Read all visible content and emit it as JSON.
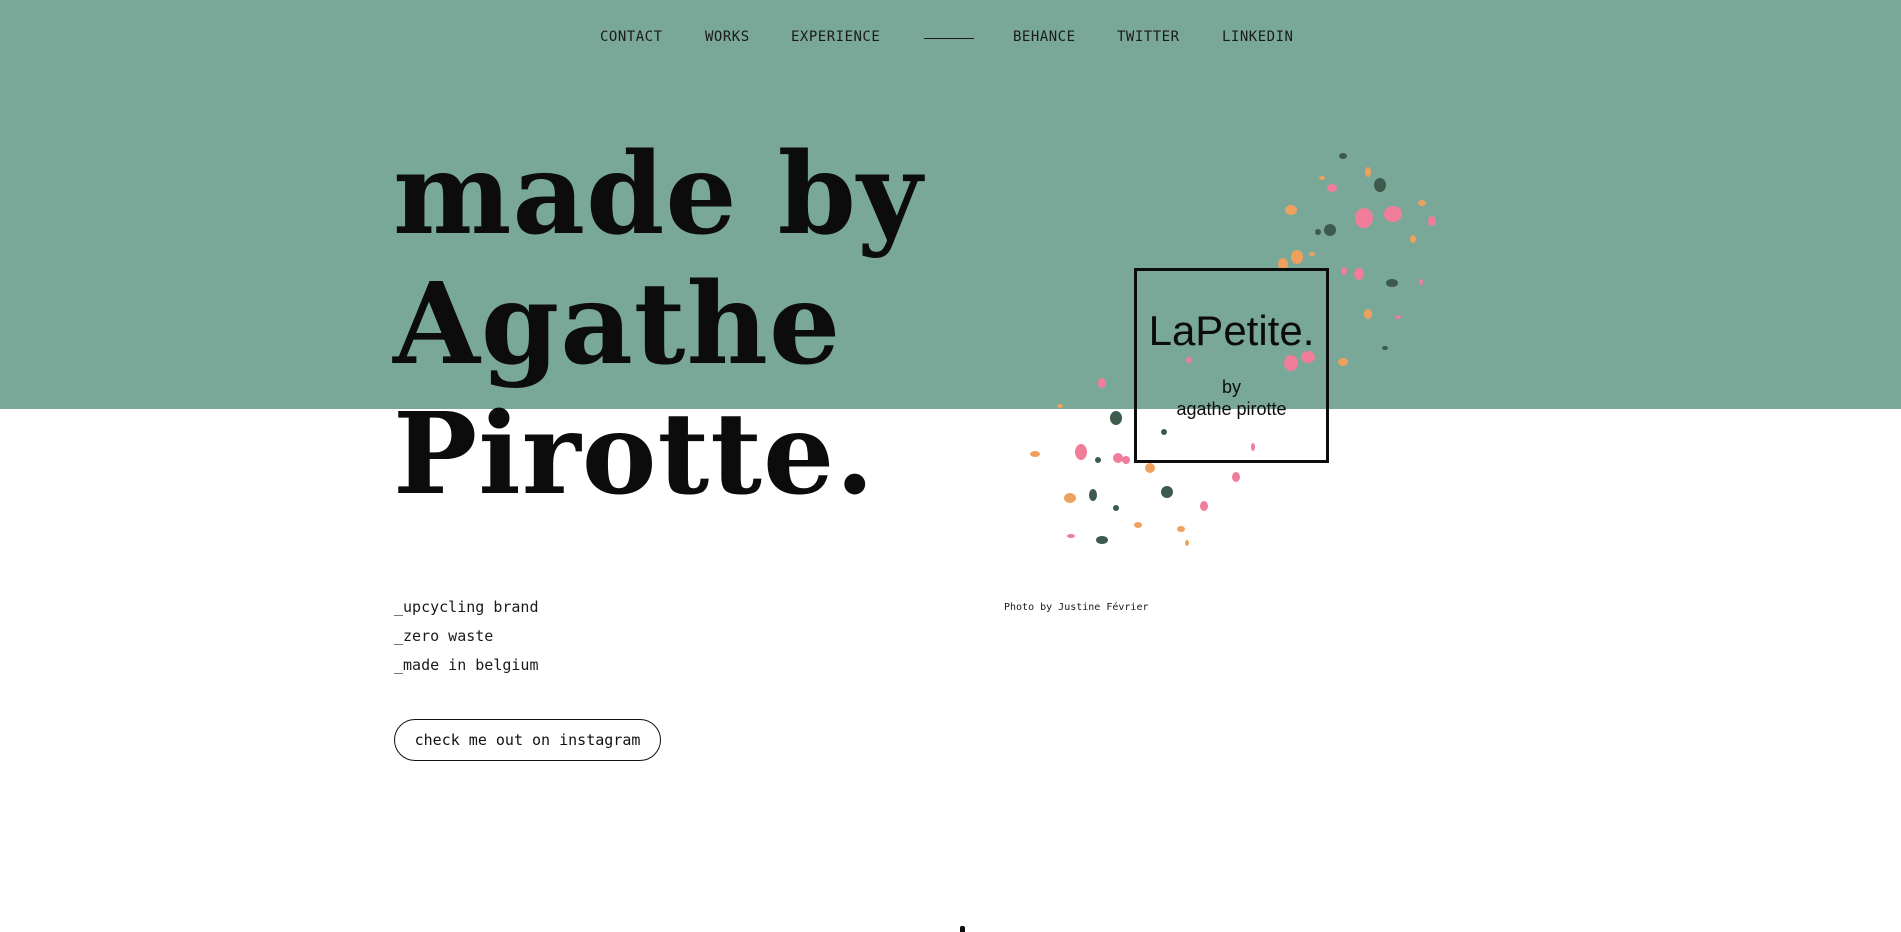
{
  "nav": {
    "links": [
      {
        "label": "CONTACT"
      },
      {
        "label": "WORKS"
      },
      {
        "label": "EXPERIENCE"
      },
      {
        "label": "BEHANCE"
      },
      {
        "label": "TWITTER"
      },
      {
        "label": "LINKEDIN"
      }
    ]
  },
  "hero": {
    "line1": "made by",
    "line2": "Agathe",
    "line3": "Pirotte."
  },
  "taglines": [
    "_upcycling brand",
    "_zero waste",
    "_made in belgium"
  ],
  "cta": {
    "label": "check me out on instagram"
  },
  "logo": {
    "title": "LaPetite.",
    "by": "by",
    "name": "agathe pirotte"
  },
  "photo_credit": "Photo by Justine Février",
  "colors": {
    "band": "#7aa898",
    "confetti_pink": "#f07d9a",
    "confetti_orange": "#eea15c",
    "confetti_dark": "#3d5a4c"
  }
}
